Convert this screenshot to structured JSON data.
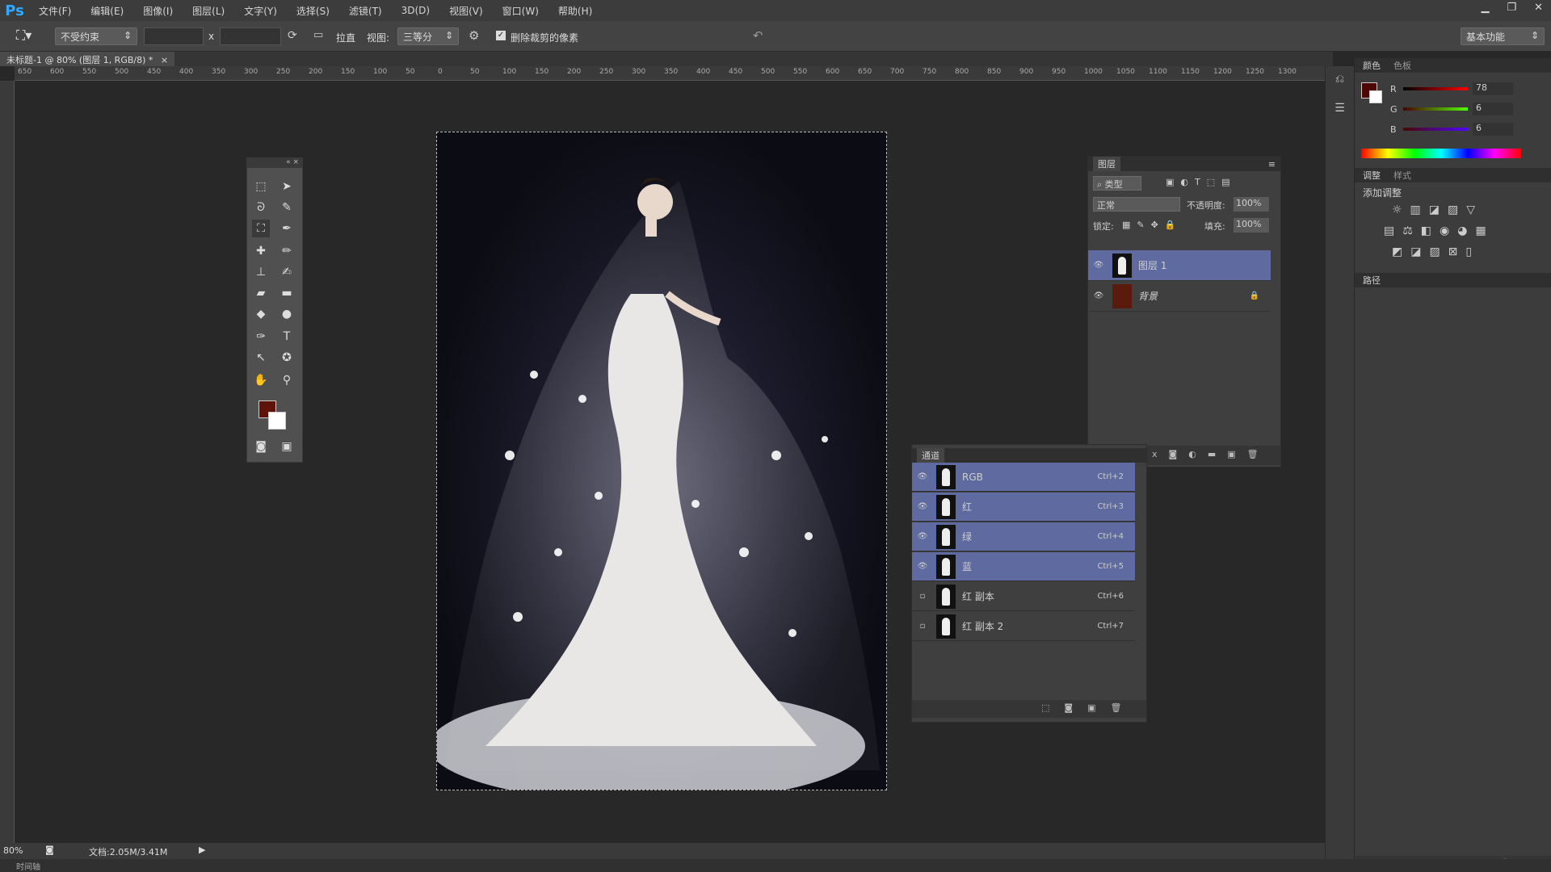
{
  "app": {
    "logo": "Ps"
  },
  "menu": [
    "文件(F)",
    "编辑(E)",
    "图像(I)",
    "图层(L)",
    "文字(Y)",
    "选择(S)",
    "滤镜(T)",
    "3D(D)",
    "视图(V)",
    "窗口(W)",
    "帮助(H)"
  ],
  "options": {
    "ratio_select": "不受约束",
    "x_sep": "x",
    "straighten_label": "拉直",
    "view_label": "视图:",
    "view_select": "三等分",
    "delete_cropped_label": "删除裁剪的像素",
    "delete_cropped_checked": true,
    "workspace_select": "基本功能"
  },
  "document": {
    "tab_title": "未标题-1 @ 80% (图层 1, RGB/8) *"
  },
  "ruler": {
    "h_ticks": [
      "650",
      "600",
      "550",
      "500",
      "450",
      "400",
      "350",
      "300",
      "250",
      "200",
      "150",
      "100",
      "50",
      "0",
      "50",
      "100",
      "150",
      "200",
      "250",
      "300",
      "350",
      "400",
      "450",
      "500",
      "550",
      "600",
      "650",
      "700",
      "750",
      "800",
      "850",
      "900",
      "950",
      "1000",
      "1050",
      "1100",
      "1150",
      "1200",
      "1250",
      "1300"
    ]
  },
  "layers_panel": {
    "title": "图层",
    "kind_filter": "类型",
    "blend_mode": "正常",
    "opacity_label": "不透明度:",
    "opacity_value": "100%",
    "lock_label": "锁定:",
    "fill_label": "填充:",
    "fill_value": "100%",
    "layers": [
      {
        "name": "图层 1",
        "selected": true
      },
      {
        "name": "背景",
        "selected": false,
        "locked": true,
        "swatch": "#5a1a0c"
      }
    ]
  },
  "channels_panel": {
    "title": "通道",
    "channels": [
      {
        "name": "RGB",
        "shortcut": "Ctrl+2",
        "visible": true
      },
      {
        "name": "红",
        "shortcut": "Ctrl+3",
        "visible": true
      },
      {
        "name": "绿",
        "shortcut": "Ctrl+4",
        "visible": true
      },
      {
        "name": "蓝",
        "shortcut": "Ctrl+5",
        "visible": true
      },
      {
        "name": "红 副本",
        "shortcut": "Ctrl+6",
        "visible": false
      },
      {
        "name": "红 副本 2",
        "shortcut": "Ctrl+7",
        "visible": false
      }
    ]
  },
  "color_panel": {
    "tabs": [
      "颜色",
      "色板"
    ],
    "R": "78",
    "G": "6",
    "B": "6",
    "foreground": "#4e0606",
    "background": "#ffffff"
  },
  "adjust_panel": {
    "tabs": [
      "调整",
      "样式"
    ],
    "add_label": "添加调整"
  },
  "paths_panel": {
    "title": "路径"
  },
  "status": {
    "zoom": "80%",
    "doc_info": "文档:2.05M/3.41M"
  },
  "timeline": {
    "label": "时间轴"
  },
  "colors": {
    "selection_blue": "#5e6aa0",
    "accent": "#31a8ff"
  }
}
